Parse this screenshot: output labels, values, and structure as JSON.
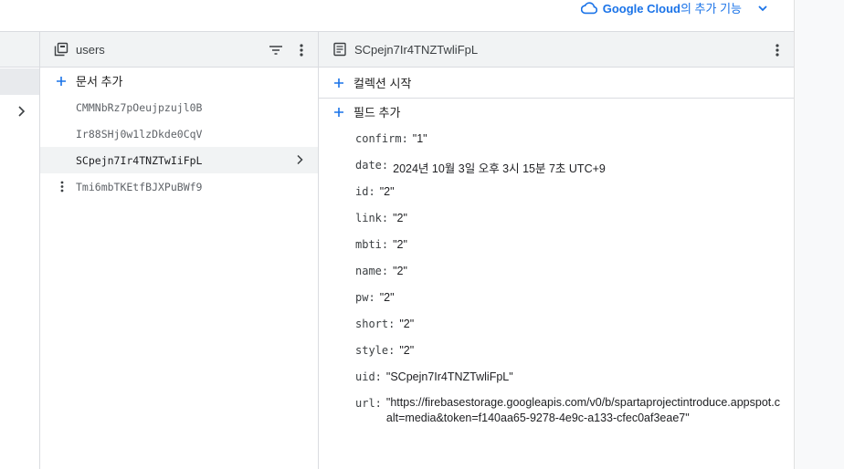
{
  "topbar": {
    "google_cloud_label": "Google Cloud",
    "google_cloud_suffix": "의 추가 기능"
  },
  "middle": {
    "collection_title": "users",
    "add_document_label": "문서 추가",
    "documents": [
      "CMMNbRz7pOeujpzujl0B",
      "Ir88SHj0w1lzDkde0CqV",
      "SCpejn7Ir4TNZTwIiFpL",
      "Tmi6mbTKEtfBJXPuBWf9"
    ]
  },
  "right": {
    "document_title": "SCpejn7Ir4TNZTwliFpL",
    "start_collection_label": "컬렉션 시작",
    "add_field_label": "필드 추가",
    "fields": [
      {
        "key": "confirm:",
        "value": "\"1\""
      },
      {
        "key": "date:",
        "value": "2024년 10월 3일 오후 3시 15분 7초 UTC+9"
      },
      {
        "key": "id:",
        "value": "\"2\""
      },
      {
        "key": "link:",
        "value": "\"2\""
      },
      {
        "key": "mbti:",
        "value": "\"2\""
      },
      {
        "key": "name:",
        "value": "\"2\""
      },
      {
        "key": "pw:",
        "value": "\"2\""
      },
      {
        "key": "short:",
        "value": "\"2\""
      },
      {
        "key": "style:",
        "value": "\"2\""
      },
      {
        "key": "uid:",
        "value": "\"SCpejn7Ir4TNZTwliFpL\""
      }
    ],
    "url_field": {
      "key": "url:",
      "value_line1": "\"https://firebasestorage.googleapis.com/v0/b/spartaprojectintroduce.appspot.c",
      "value_line2": "alt=media&token=f140aa65-9278-4e9c-a133-cfec0af3eae7\""
    }
  },
  "colors": {
    "accent": "#1a73e8",
    "header_bg": "#f1f3f4",
    "selected_bg": "#f1f3f4",
    "border": "#dadce0"
  }
}
